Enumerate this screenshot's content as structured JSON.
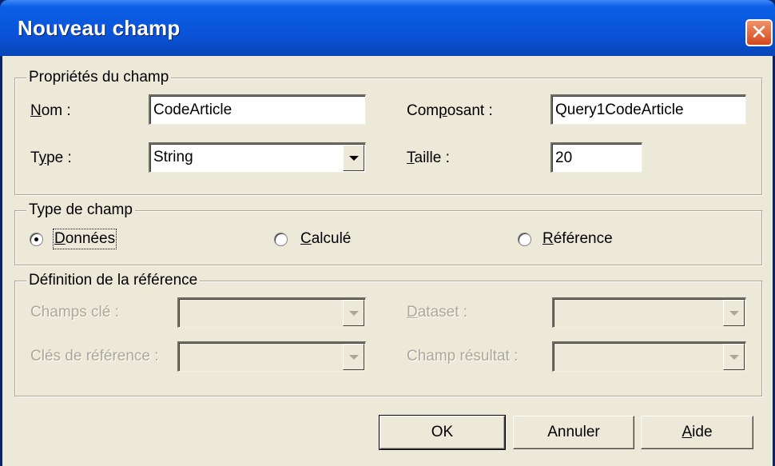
{
  "window": {
    "title": "Nouveau champ",
    "close_glyph": "✕",
    "close_icon": "close-icon"
  },
  "props": {
    "legend": "Propriétés du champ",
    "nom_mnemonic": "N",
    "nom_rest": "om :",
    "nom_value": "CodeArticle",
    "composant_pre": "Com",
    "composant_mnemonic": "p",
    "composant_rest": "osant :",
    "composant_value": "Query1CodeArticle",
    "type_pre": "T",
    "type_mnemonic": "y",
    "type_rest": "pe :",
    "type_value": "String",
    "taille_mnemonic": "T",
    "taille_rest": "aille :",
    "taille_value": "20"
  },
  "fieldtype": {
    "legend": "Type de champ",
    "options": [
      {
        "mnemonic": "D",
        "rest": "onnées",
        "selected": true
      },
      {
        "mnemonic": "C",
        "rest": "alculé",
        "selected": false
      },
      {
        "mnemonic": "R",
        "rest": "éférence",
        "selected": false
      }
    ]
  },
  "reference": {
    "legend": "Définition de la référence",
    "champs_cle": "Champs clé :",
    "dataset_mnemonic": "D",
    "dataset_rest": "ataset :",
    "cles_reference": "Clés de référence :",
    "champ_resultat": "Champ résultat :"
  },
  "buttons": {
    "ok": "OK",
    "annuler": "Annuler",
    "aide_mnemonic": "A",
    "aide_rest": "ide"
  }
}
